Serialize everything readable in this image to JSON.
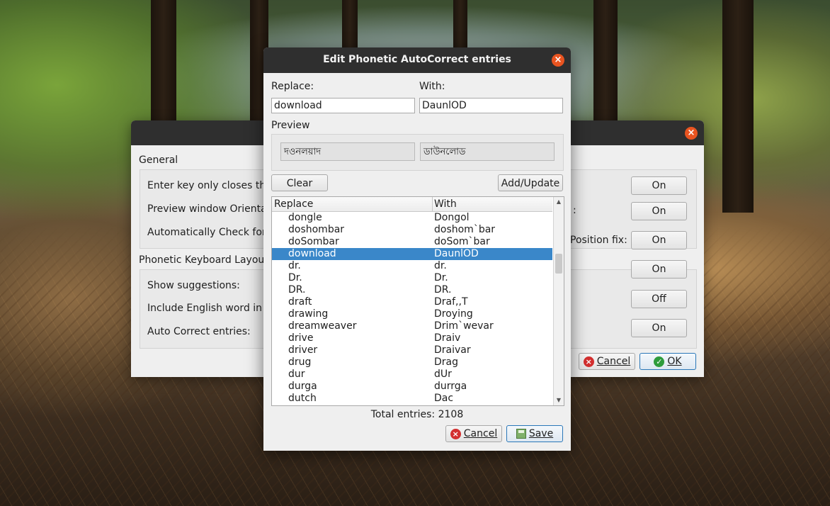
{
  "back_dialog": {
    "sections": {
      "general": "General",
      "phonetic": "Phonetic Keyboard Layout"
    },
    "rows": [
      {
        "label": "Enter key only closes the",
        "value": "On"
      },
      {
        "label": "Preview window Orienta",
        "right_label": ":",
        "value": "On"
      },
      {
        "label": "Automatically Check for",
        "right_label": "Position fix:",
        "value": "On"
      },
      {
        "label": "Show suggestions:",
        "value": "On"
      },
      {
        "label": "Include English word in t",
        "value": "Off"
      },
      {
        "label": "Auto Correct entries:",
        "value": "On"
      }
    ],
    "cancel_label": "Cancel",
    "ok_label": "OK"
  },
  "dialog": {
    "title": "Edit Phonetic AutoCorrect entries",
    "replace_label": "Replace:",
    "with_label": "With:",
    "replace_value": "download",
    "with_value": "DaunlOD",
    "preview_label": "Preview",
    "preview_replace": "দওনলয়াদ",
    "preview_with": "ডাউনলোড",
    "clear_label": "Clear",
    "add_update_label": "Add/Update",
    "table": {
      "headers": [
        "Replace",
        "With"
      ],
      "rows": [
        [
          "dongle",
          "Dongol"
        ],
        [
          "doshombar",
          "doshom`bar"
        ],
        [
          "doSombar",
          "doSom`bar"
        ],
        [
          "download",
          "DaunlOD"
        ],
        [
          "dr.",
          "dr."
        ],
        [
          "Dr.",
          "Dr."
        ],
        [
          "DR.",
          "DR."
        ],
        [
          "draft",
          "Draf,,T"
        ],
        [
          "drawing",
          "Droying"
        ],
        [
          "dreamweaver",
          "Drim`wevar"
        ],
        [
          "drive",
          "Draiv"
        ],
        [
          "driver",
          "Draivar"
        ],
        [
          "drug",
          "Drag"
        ],
        [
          "dur",
          "dUr"
        ],
        [
          "durga",
          "durrga"
        ],
        [
          "dutch",
          "Dac"
        ]
      ],
      "selected_index": 3
    },
    "total_label": "Total entries: 2108",
    "cancel_label": "Cancel",
    "save_label": "Save"
  },
  "colors": {
    "titlebar": "#2f2f2f",
    "close_button": "#e95420",
    "selection": "#3a87c9"
  }
}
